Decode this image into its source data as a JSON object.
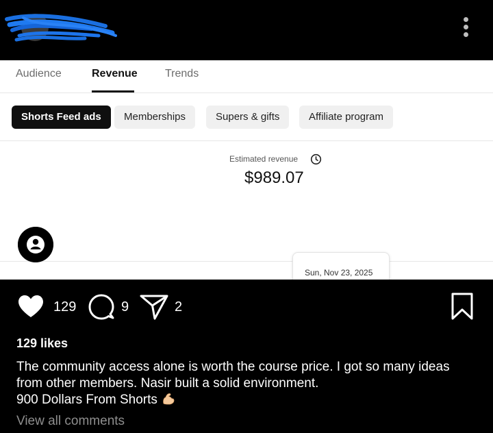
{
  "header": {
    "more_icon": "more-vertical-icon"
  },
  "embed": {
    "tabs": [
      {
        "label": "Audience"
      },
      {
        "label": "Revenue"
      },
      {
        "label": "Trends"
      }
    ],
    "active_tab": "Revenue",
    "chips": [
      {
        "label": "Shorts Feed ads"
      },
      {
        "label": "Memberships"
      },
      {
        "label": "Supers & gifts"
      },
      {
        "label": "Affiliate program"
      }
    ],
    "selected_chip": "Shorts Feed ads",
    "metric_label": "Estimated revenue",
    "metric_value": "$989.07",
    "tooltip_date": "Sun, Nov 23, 2025"
  },
  "post": {
    "like_count": "129",
    "comment_count": "9",
    "share_count": "2",
    "likes_text": "129 likes",
    "caption_lines": [
      "The community access alone is worth the course price. I got so many ideas",
      "from other members. Nasir built a solid environment.",
      "900 Dollars From Shorts"
    ],
    "caption_emoji": "flexed-biceps-emoji",
    "view_comments": "View all comments"
  },
  "colors": {
    "background": "#000000",
    "embed_background": "#ffffff",
    "selected_chip": "#0f0f0f",
    "chip": "#f0f0f0",
    "scribble": "#1a73e8",
    "muted_text": "#8e8e8e"
  }
}
